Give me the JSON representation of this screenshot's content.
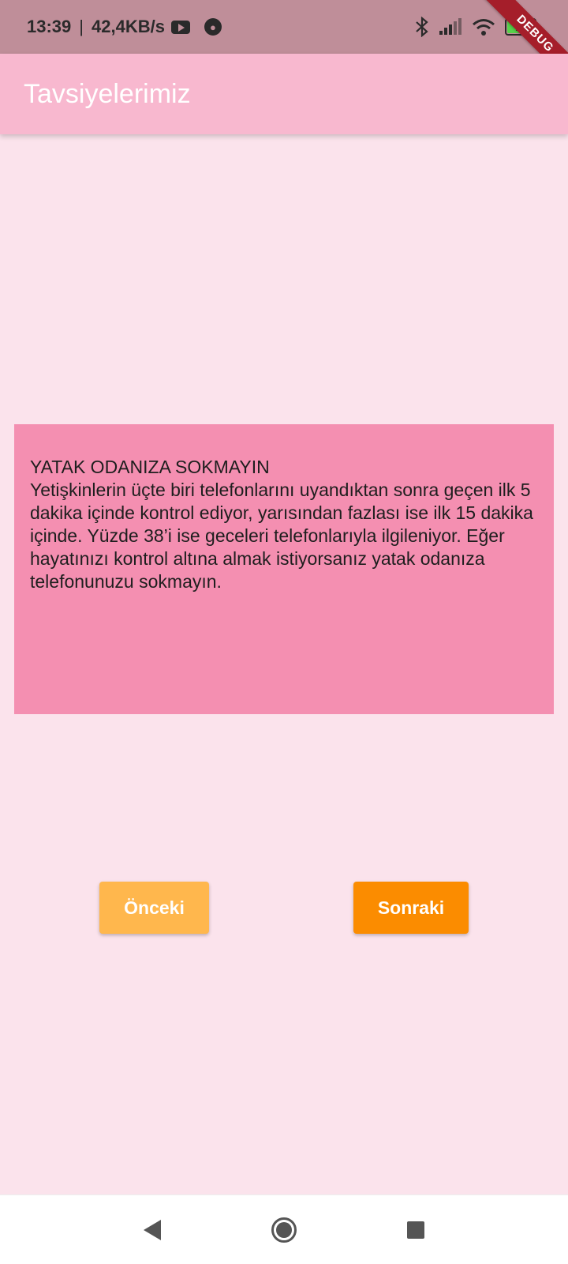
{
  "status_bar": {
    "time": "13:39",
    "separator": "|",
    "network_speed": "42,4KB/s",
    "battery_level": "70",
    "battery_fraction": 0.7,
    "icons": [
      "youtube-icon",
      "app-notification-icon",
      "bluetooth-icon",
      "signal-icon",
      "wifi-icon",
      "battery-icon"
    ]
  },
  "debug_banner": "DEBUG",
  "app_bar": {
    "title": "Tavsiyelerimiz"
  },
  "tip": {
    "title": "YATAK ODANIZA SOKMAYIN",
    "body": " Yetişkinlerin üçte biri telefonlarını uyandıktan sonra geçen ilk 5 dakika içinde kontrol ediyor, yarısından fazlası ise ilk 15 dakika içinde. Yüzde 38’i ise geceleri telefonlarıyla ilgileniyor. Eğer hayatınızı kontrol altına almak istiyorsanız yatak odanıza telefonunuzu sokmayın."
  },
  "buttons": {
    "previous": "Önceki",
    "next": "Sonraki"
  },
  "colors": {
    "background": "#fbe3ec",
    "app_bar": "#f8b8cf",
    "card": "#f48fb1",
    "previous_button": "#ffb74d",
    "next_button": "#fb8c00"
  }
}
